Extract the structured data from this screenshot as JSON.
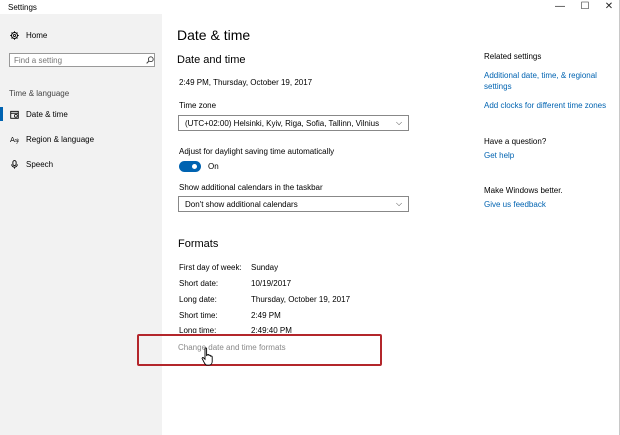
{
  "window": {
    "title": "Settings",
    "minimize": "—",
    "maximize": "☐",
    "close": "✕"
  },
  "sidebar": {
    "home": "Home",
    "search_placeholder": "Find a setting",
    "section": "Time & language",
    "items": [
      {
        "label": "Date & time",
        "icon": "calendar-icon",
        "active": true
      },
      {
        "label": "Region & language",
        "icon": "globe-icon",
        "active": false
      },
      {
        "label": "Speech",
        "icon": "microphone-icon",
        "active": false
      }
    ]
  },
  "main": {
    "page_title": "Date & time",
    "date_time_heading": "Date and time",
    "current_datetime": "2:49 PM, Thursday, October 19, 2017",
    "timezone_label": "Time zone",
    "timezone_value": "(UTC+02:00) Helsinki, Kyiv, Riga, Sofia, Tallinn, Vilnius",
    "dst_label": "Adjust for daylight saving time automatically",
    "dst_state": "On",
    "calendars_label": "Show additional calendars in the taskbar",
    "calendars_value": "Don't show additional calendars",
    "formats_heading": "Formats",
    "formats": [
      {
        "key": "First day of week:",
        "value": "Sunday"
      },
      {
        "key": "Short date:",
        "value": "10/19/2017"
      },
      {
        "key": "Long date:",
        "value": "Thursday, October 19, 2017"
      },
      {
        "key": "Short time:",
        "value": "2:49 PM"
      },
      {
        "key": "Long time:",
        "value": "2:49:40 PM"
      }
    ],
    "change_formats_link": "Change date and time formats"
  },
  "related": {
    "heading": "Related settings",
    "link1": "Additional date, time, & regional settings",
    "link2": "Add clocks for different time zones",
    "question_heading": "Have a question?",
    "get_help": "Get help",
    "better_heading": "Make Windows better.",
    "feedback": "Give us feedback"
  },
  "colors": {
    "accent": "#0063b1",
    "highlight": "#b3262b"
  }
}
